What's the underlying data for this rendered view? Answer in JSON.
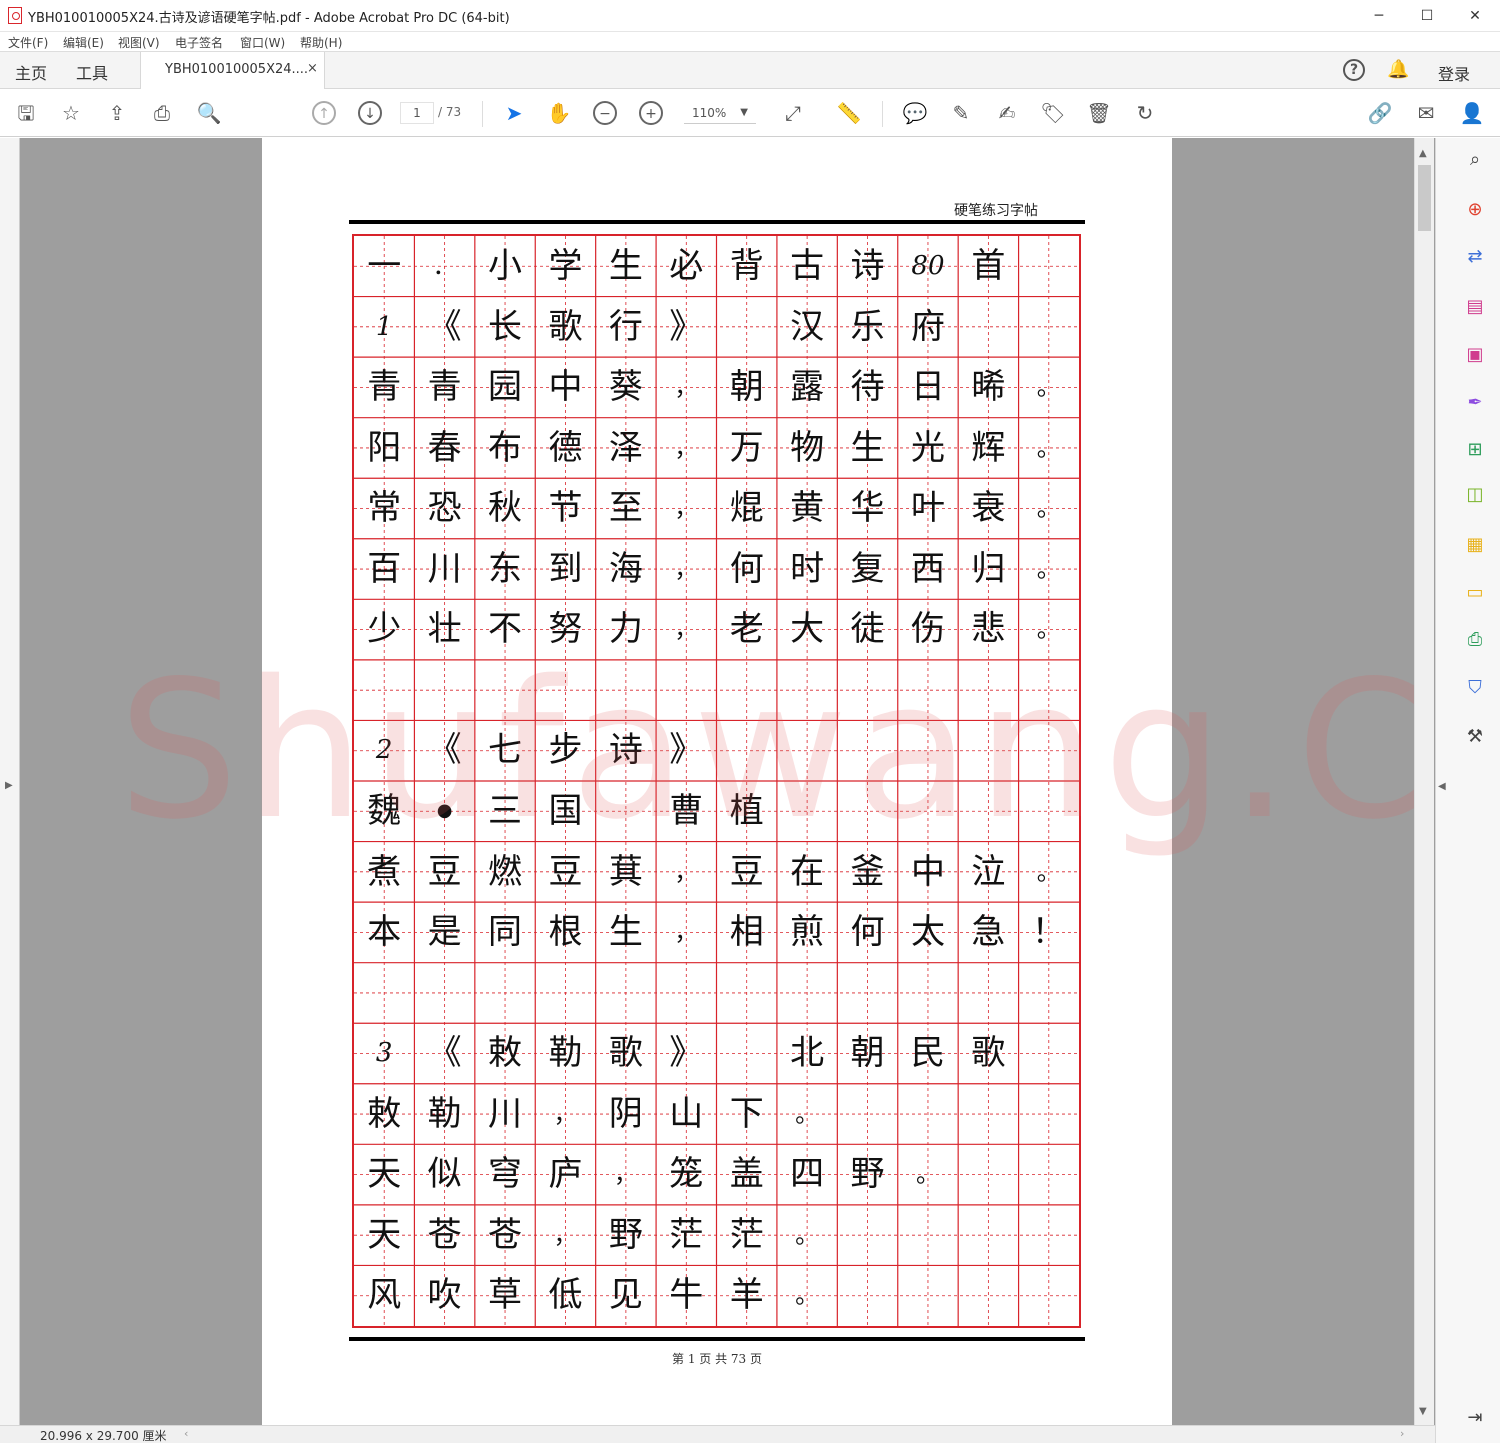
{
  "window": {
    "title": "YBH010010005X24.古诗及谚语硬笔字帖.pdf - Adobe Acrobat Pro DC (64-bit)",
    "minimize": "─",
    "maximize": "☐",
    "close": "✕"
  },
  "menu": [
    "文件(F)",
    "编辑(E)",
    "视图(V)",
    "电子签名",
    "窗口(W)",
    "帮助(H)"
  ],
  "tabs": {
    "home": "主页",
    "tools": "工具",
    "document": "YBH010010005X24....",
    "close": "×",
    "help": "?",
    "bell": "🔔",
    "login": "登录"
  },
  "toolbar": {
    "page_current": "1",
    "page_total": "/ 73",
    "zoom": "110%",
    "zoom_caret": "▼",
    "icons": {
      "save": "🖫",
      "bookmark": "☆",
      "upload": "⇪",
      "print": "⎙",
      "zoom_out_search": "🔍",
      "page_up": "↑",
      "page_down": "↓",
      "select": "➤",
      "hand": "✋",
      "zoom_minus": "−",
      "zoom_plus": "+",
      "fit_page": "⤢",
      "measure": "📏",
      "comment": "💬",
      "highlight": "✎",
      "sign": "✍",
      "stamp": "🏷",
      "delete": "🗑",
      "rotate": "↻",
      "share_link": "🔗",
      "email": "✉",
      "add_user": "👤"
    }
  },
  "document": {
    "header": "硬笔练习字帖",
    "footer": "第 1 页 共 73 页",
    "watermark": "Shufawang.CN",
    "grid": {
      "rows": 18,
      "cols": 12,
      "content": [
        [
          "一",
          "．",
          "小",
          "学",
          "生",
          "必",
          "背",
          "古",
          "诗",
          "80",
          "首",
          ""
        ],
        [
          "1",
          "《",
          "长",
          "歌",
          "行",
          "》",
          "",
          "汉",
          "乐",
          "府",
          "",
          ""
        ],
        [
          "青",
          "青",
          "园",
          "中",
          "葵",
          "，",
          "朝",
          "露",
          "待",
          "日",
          "晞",
          "。"
        ],
        [
          "阳",
          "春",
          "布",
          "德",
          "泽",
          "，",
          "万",
          "物",
          "生",
          "光",
          "辉",
          "。"
        ],
        [
          "常",
          "恐",
          "秋",
          "节",
          "至",
          "，",
          "焜",
          "黄",
          "华",
          "叶",
          "衰",
          "。"
        ],
        [
          "百",
          "川",
          "东",
          "到",
          "海",
          "，",
          "何",
          "时",
          "复",
          "西",
          "归",
          "。"
        ],
        [
          "少",
          "壮",
          "不",
          "努",
          "力",
          "，",
          "老",
          "大",
          "徒",
          "伤",
          "悲",
          "。"
        ],
        [
          "",
          "",
          "",
          "",
          "",
          "",
          "",
          "",
          "",
          "",
          "",
          ""
        ],
        [
          "2",
          "《",
          "七",
          "步",
          "诗",
          "》",
          "",
          "",
          "",
          "",
          "",
          ""
        ],
        [
          "魏",
          "●",
          "三",
          "国",
          "",
          "曹",
          "植",
          "",
          "",
          "",
          "",
          ""
        ],
        [
          "煮",
          "豆",
          "燃",
          "豆",
          "萁",
          "，",
          "豆",
          "在",
          "釜",
          "中",
          "泣",
          "。"
        ],
        [
          "本",
          "是",
          "同",
          "根",
          "生",
          "，",
          "相",
          "煎",
          "何",
          "太",
          "急",
          "！"
        ],
        [
          "",
          "",
          "",
          "",
          "",
          "",
          "",
          "",
          "",
          "",
          "",
          ""
        ],
        [
          "3",
          "《",
          "敕",
          "勒",
          "歌",
          "》",
          "",
          "北",
          "朝",
          "民",
          "歌",
          ""
        ],
        [
          "敕",
          "勒",
          "川",
          "，",
          "阴",
          "山",
          "下",
          "。",
          "",
          "",
          "",
          ""
        ],
        [
          "天",
          "似",
          "穹",
          "庐",
          "，",
          "笼",
          "盖",
          "四",
          "野",
          "。",
          "",
          ""
        ],
        [
          "天",
          "苍",
          "苍",
          "，",
          "野",
          "茫",
          "茫",
          "。",
          "",
          "",
          "",
          ""
        ],
        [
          "风",
          "吹",
          "草",
          "低",
          "见",
          "牛",
          "羊",
          "。",
          "",
          "",
          "",
          ""
        ]
      ]
    }
  },
  "status": {
    "dimensions": "20.996 x 29.700 厘米"
  },
  "colors": {
    "grid_red": "#d8232a",
    "accent_blue": "#1473e6",
    "viewer_gray": "#9e9e9e"
  }
}
